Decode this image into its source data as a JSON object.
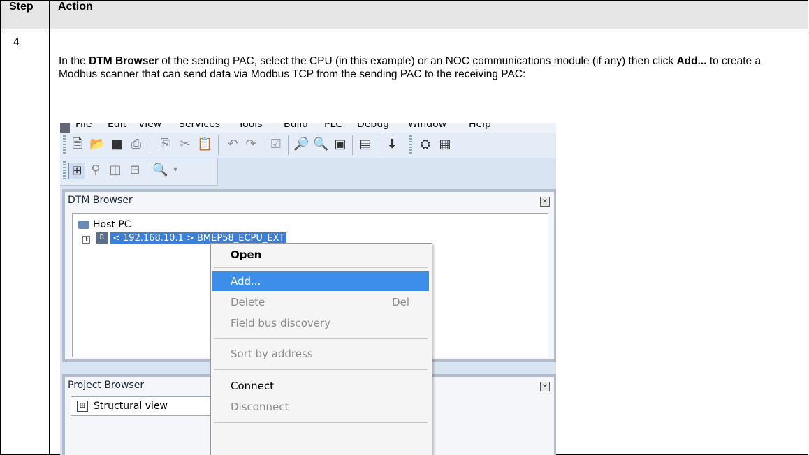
{
  "table": {
    "header_step": "Step",
    "header_action": "Action",
    "step_number": "4"
  },
  "instruction": {
    "t1": "In the ",
    "b1": "DTM Browser",
    "t2": " of the sending PAC, select the CPU (in this example) or an NOC communications module (if any) then click ",
    "b2": "Add...",
    "t3": " to create a Modbus scanner that can send data via Modbus TCP from the sending PAC to the receiving PAC:"
  },
  "app": {
    "menu": [
      "File",
      "Edit",
      "View",
      "Services",
      "Tools",
      "Build",
      "PLC",
      "Debug",
      "Window",
      "Help"
    ],
    "dtm_browser": {
      "title": "DTM Browser",
      "host": "Host PC",
      "node": "< 192.168.10.1 > BMEP58_ECPU_EXT"
    },
    "context_menu": {
      "open": "Open",
      "add": "Add...",
      "delete": "Delete",
      "delete_shortcut": "Del",
      "field_bus": "Field bus discovery",
      "sort": "Sort  by address",
      "connect": "Connect",
      "disconnect": "Disconnect"
    },
    "project_browser": {
      "title": "Project Browser",
      "structural_view": "Structural view"
    }
  }
}
